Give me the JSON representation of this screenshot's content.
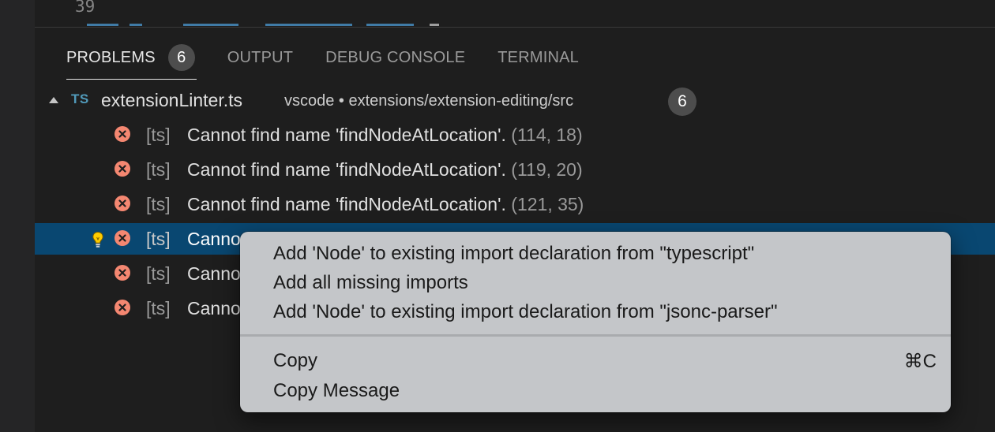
{
  "editor": {
    "line_number": "39"
  },
  "panel": {
    "tabs": [
      {
        "label": "PROBLEMS",
        "badge": "6",
        "active": true
      },
      {
        "label": "OUTPUT"
      },
      {
        "label": "DEBUG CONSOLE"
      },
      {
        "label": "TERMINAL"
      }
    ],
    "file": {
      "icon_label": "TS",
      "name": "extensionLinter.ts",
      "path": "vscode • extensions/extension-editing/src",
      "count": "6"
    },
    "problems": [
      {
        "source": "[ts]",
        "message": "Cannot find name 'findNodeAtLocation'.",
        "location": "(114, 18)"
      },
      {
        "source": "[ts]",
        "message": "Cannot find name 'findNodeAtLocation'.",
        "location": "(119, 20)"
      },
      {
        "source": "[ts]",
        "message": "Cannot find name 'findNodeAtLocation'.",
        "location": "(121, 35)"
      },
      {
        "source": "[ts]",
        "message": "Canno",
        "location": "",
        "selected": true
      },
      {
        "source": "[ts]",
        "message": "Canno",
        "location": ""
      },
      {
        "source": "[ts]",
        "message": "Canno",
        "location": ""
      }
    ]
  },
  "context_menu": {
    "items": [
      {
        "label": "Add 'Node' to existing import declaration from \"typescript\""
      },
      {
        "label": "Add all missing imports"
      },
      {
        "label": "Add 'Node' to existing import declaration from \"jsonc-parser\""
      },
      {
        "label": "Copy",
        "shortcut": "⌘C"
      },
      {
        "label": "Copy Message"
      }
    ]
  },
  "colors": {
    "error": "#f48771",
    "selection": "#094771",
    "ts_blue": "#519aba",
    "menu_bg": "#c4c6c9"
  },
  "icons": {
    "error": "error-circle-icon",
    "bulb": "lightbulb-icon",
    "twistie": "chevron-expanded-icon"
  }
}
